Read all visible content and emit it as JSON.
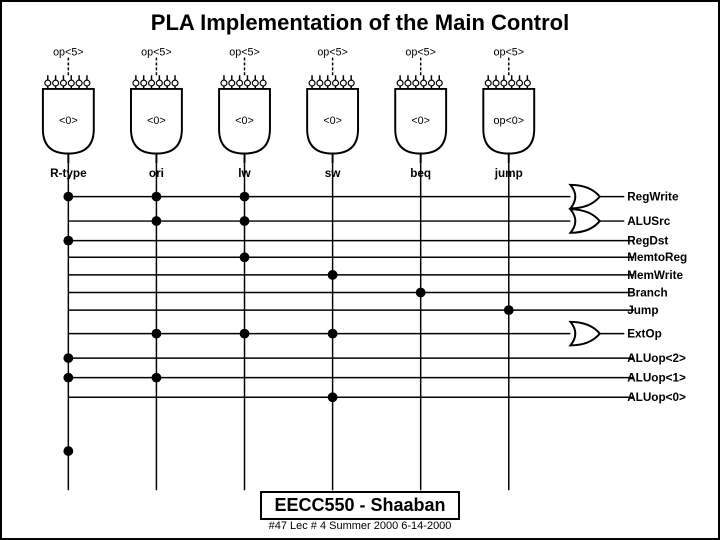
{
  "title": "PLA Implementation of the Main Control",
  "inputs": [
    "op<5>",
    "op<5>",
    "op<5>",
    "op<5>",
    "op<5>",
    "op<5>"
  ],
  "input_labels": [
    "<0>",
    "<0>",
    "<0>",
    "<0>",
    "<0>",
    "op<0>"
  ],
  "row_labels": [
    "R-type",
    "ori",
    "lw",
    "sw",
    "beq",
    "jump"
  ],
  "outputs": [
    "RegWrite",
    "ALUSrc",
    "RegDst",
    "MemtoReg",
    "MemWrite",
    "Branch",
    "Jump",
    "ExtOp",
    "ALUop<2>",
    "ALUop<1>",
    "ALUop<0>"
  ],
  "footer": {
    "main": "EECC550 - Shaaban",
    "sub": "#47  Lec # 4  Summer 2000  6-14-2000"
  }
}
